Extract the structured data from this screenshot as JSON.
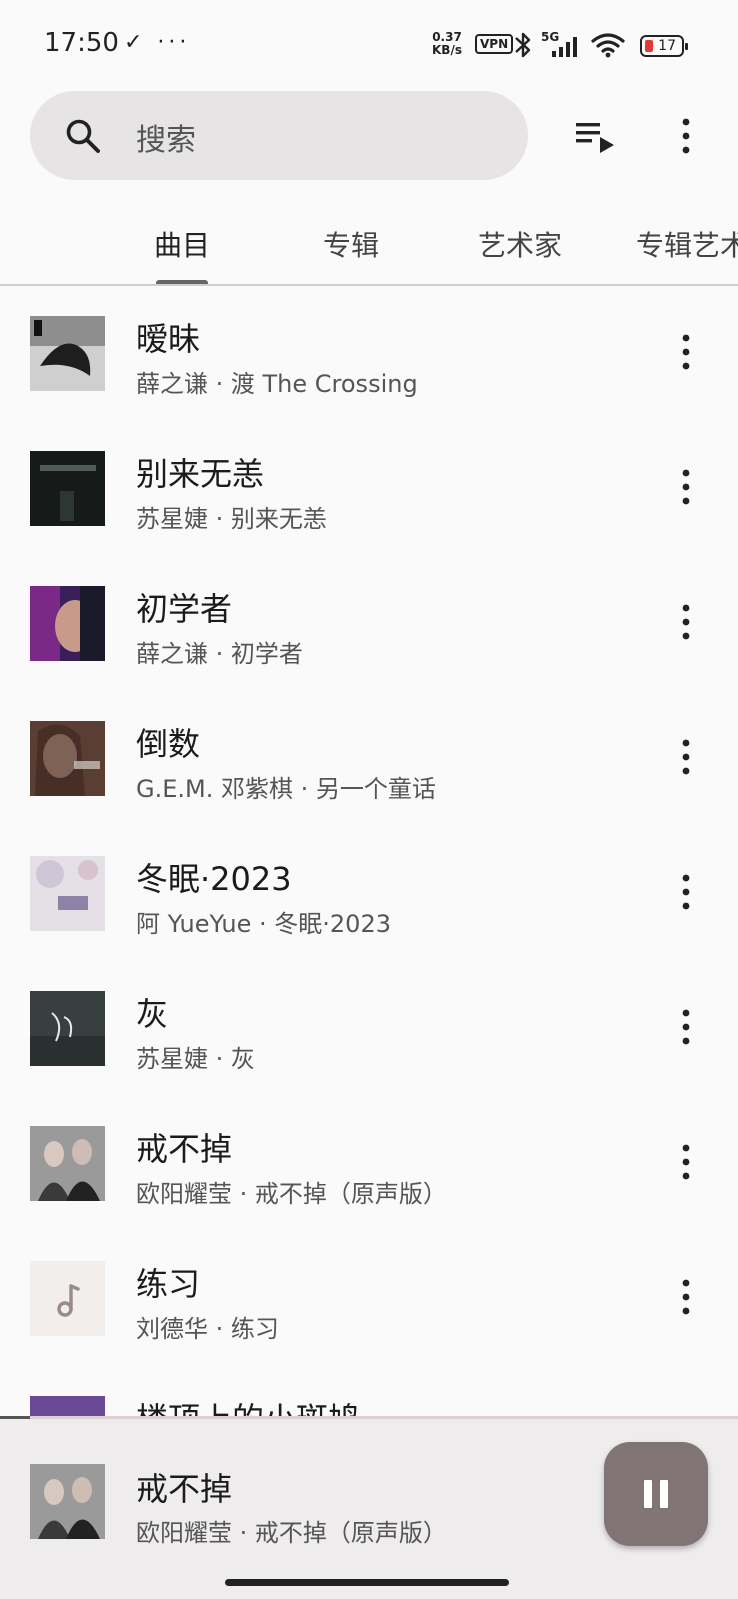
{
  "status_bar": {
    "time": "17:50",
    "left_icons": "✓ ···",
    "net_speed_value": "0.37",
    "net_speed_unit": "KB/s",
    "vpn": "VPN",
    "signal_label": "5G",
    "battery": "17"
  },
  "search": {
    "placeholder": "搜索"
  },
  "tabs": [
    {
      "label": "曲目",
      "active": true
    },
    {
      "label": "专辑",
      "active": false
    },
    {
      "label": "艺术家",
      "active": false
    },
    {
      "label": "专辑艺术家",
      "active": false
    }
  ],
  "tracks": [
    {
      "title": "暧昧",
      "subtitle": "薛之谦 · 渡 The Crossing",
      "cover_color": "#9a9a9a"
    },
    {
      "title": "别来无恙",
      "subtitle": "苏星婕 · 别来无恙",
      "cover_color": "#1e2420"
    },
    {
      "title": "初学者",
      "subtitle": "薛之谦 · 初学者",
      "cover_color": "#5a2a6a"
    },
    {
      "title": "倒数",
      "subtitle": "G.E.M. 邓紫棋 · 另一个童话",
      "cover_color": "#8a6a5a"
    },
    {
      "title": "冬眠·2023",
      "subtitle": "阿 YueYue · 冬眠·2023",
      "cover_color": "#d8d4dc"
    },
    {
      "title": "灰",
      "subtitle": "苏星婕 · 灰",
      "cover_color": "#3a4644"
    },
    {
      "title": "戒不掉",
      "subtitle": "欧阳耀莹 · 戒不掉（原声版）",
      "cover_color": "#6a6a6a"
    },
    {
      "title": "练习",
      "subtitle": "刘德华 · 练习",
      "cover_color": "#f1eeec"
    },
    {
      "title": "楼顶上的小斑鸠",
      "subtitle": "",
      "cover_color": "#8a6ab0"
    }
  ],
  "now_playing": {
    "title": "戒不掉",
    "subtitle": "欧阳耀莹 · 戒不掉（原声版）",
    "progress": 0.04
  },
  "colors": {
    "background": "#fafafa",
    "search_bg": "#e6e4e5",
    "mini_player_bg": "#eeecec",
    "pause_button": "#807474"
  }
}
